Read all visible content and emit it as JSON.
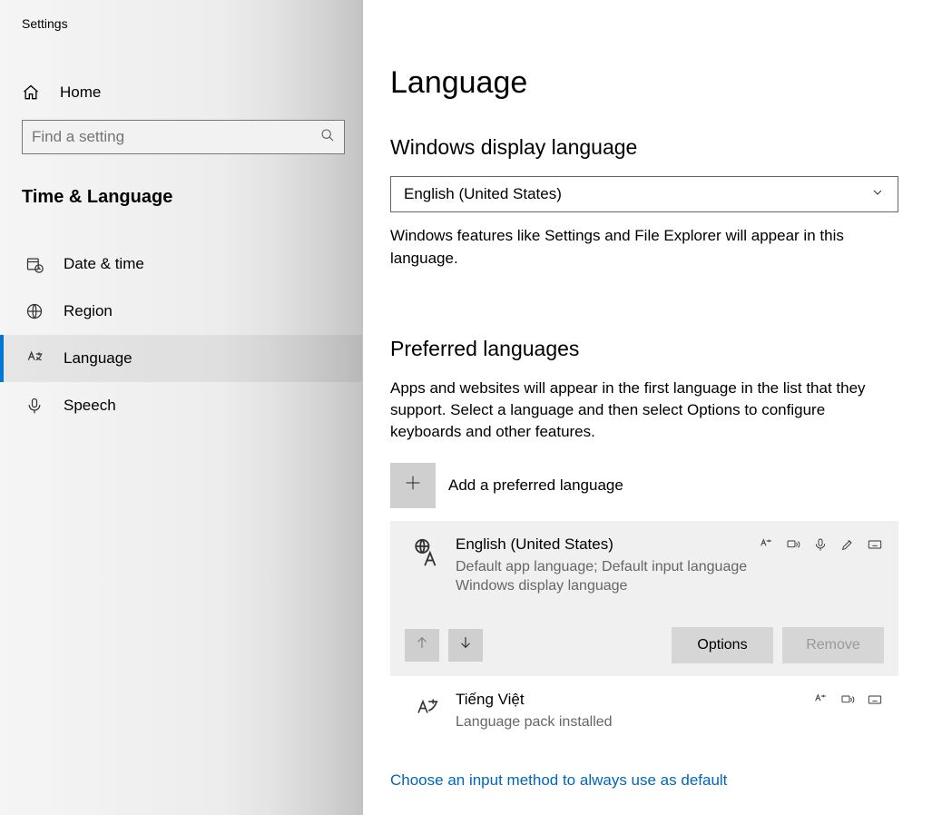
{
  "app_title": "Settings",
  "sidebar": {
    "home": "Home",
    "search_placeholder": "Find a setting",
    "section": "Time & Language",
    "items": [
      {
        "label": "Date & time"
      },
      {
        "label": "Region"
      },
      {
        "label": "Language"
      },
      {
        "label": "Speech"
      }
    ]
  },
  "main": {
    "title": "Language",
    "display": {
      "heading": "Windows display language",
      "selected": "English (United States)",
      "description": "Windows features like Settings and File Explorer will appear in this language."
    },
    "preferred": {
      "heading": "Preferred languages",
      "description": "Apps and websites will appear in the first language in the list that they support. Select a language and then select Options to configure keyboards and other features.",
      "add_label": "Add a preferred language",
      "languages": [
        {
          "name": "English (United States)",
          "sub1": "Default app language; Default input language",
          "sub2": "Windows display language"
        },
        {
          "name": "Tiếng Việt",
          "sub1": "Language pack installed"
        }
      ],
      "options_label": "Options",
      "remove_label": "Remove"
    },
    "link": "Choose an input method to always use as default"
  }
}
